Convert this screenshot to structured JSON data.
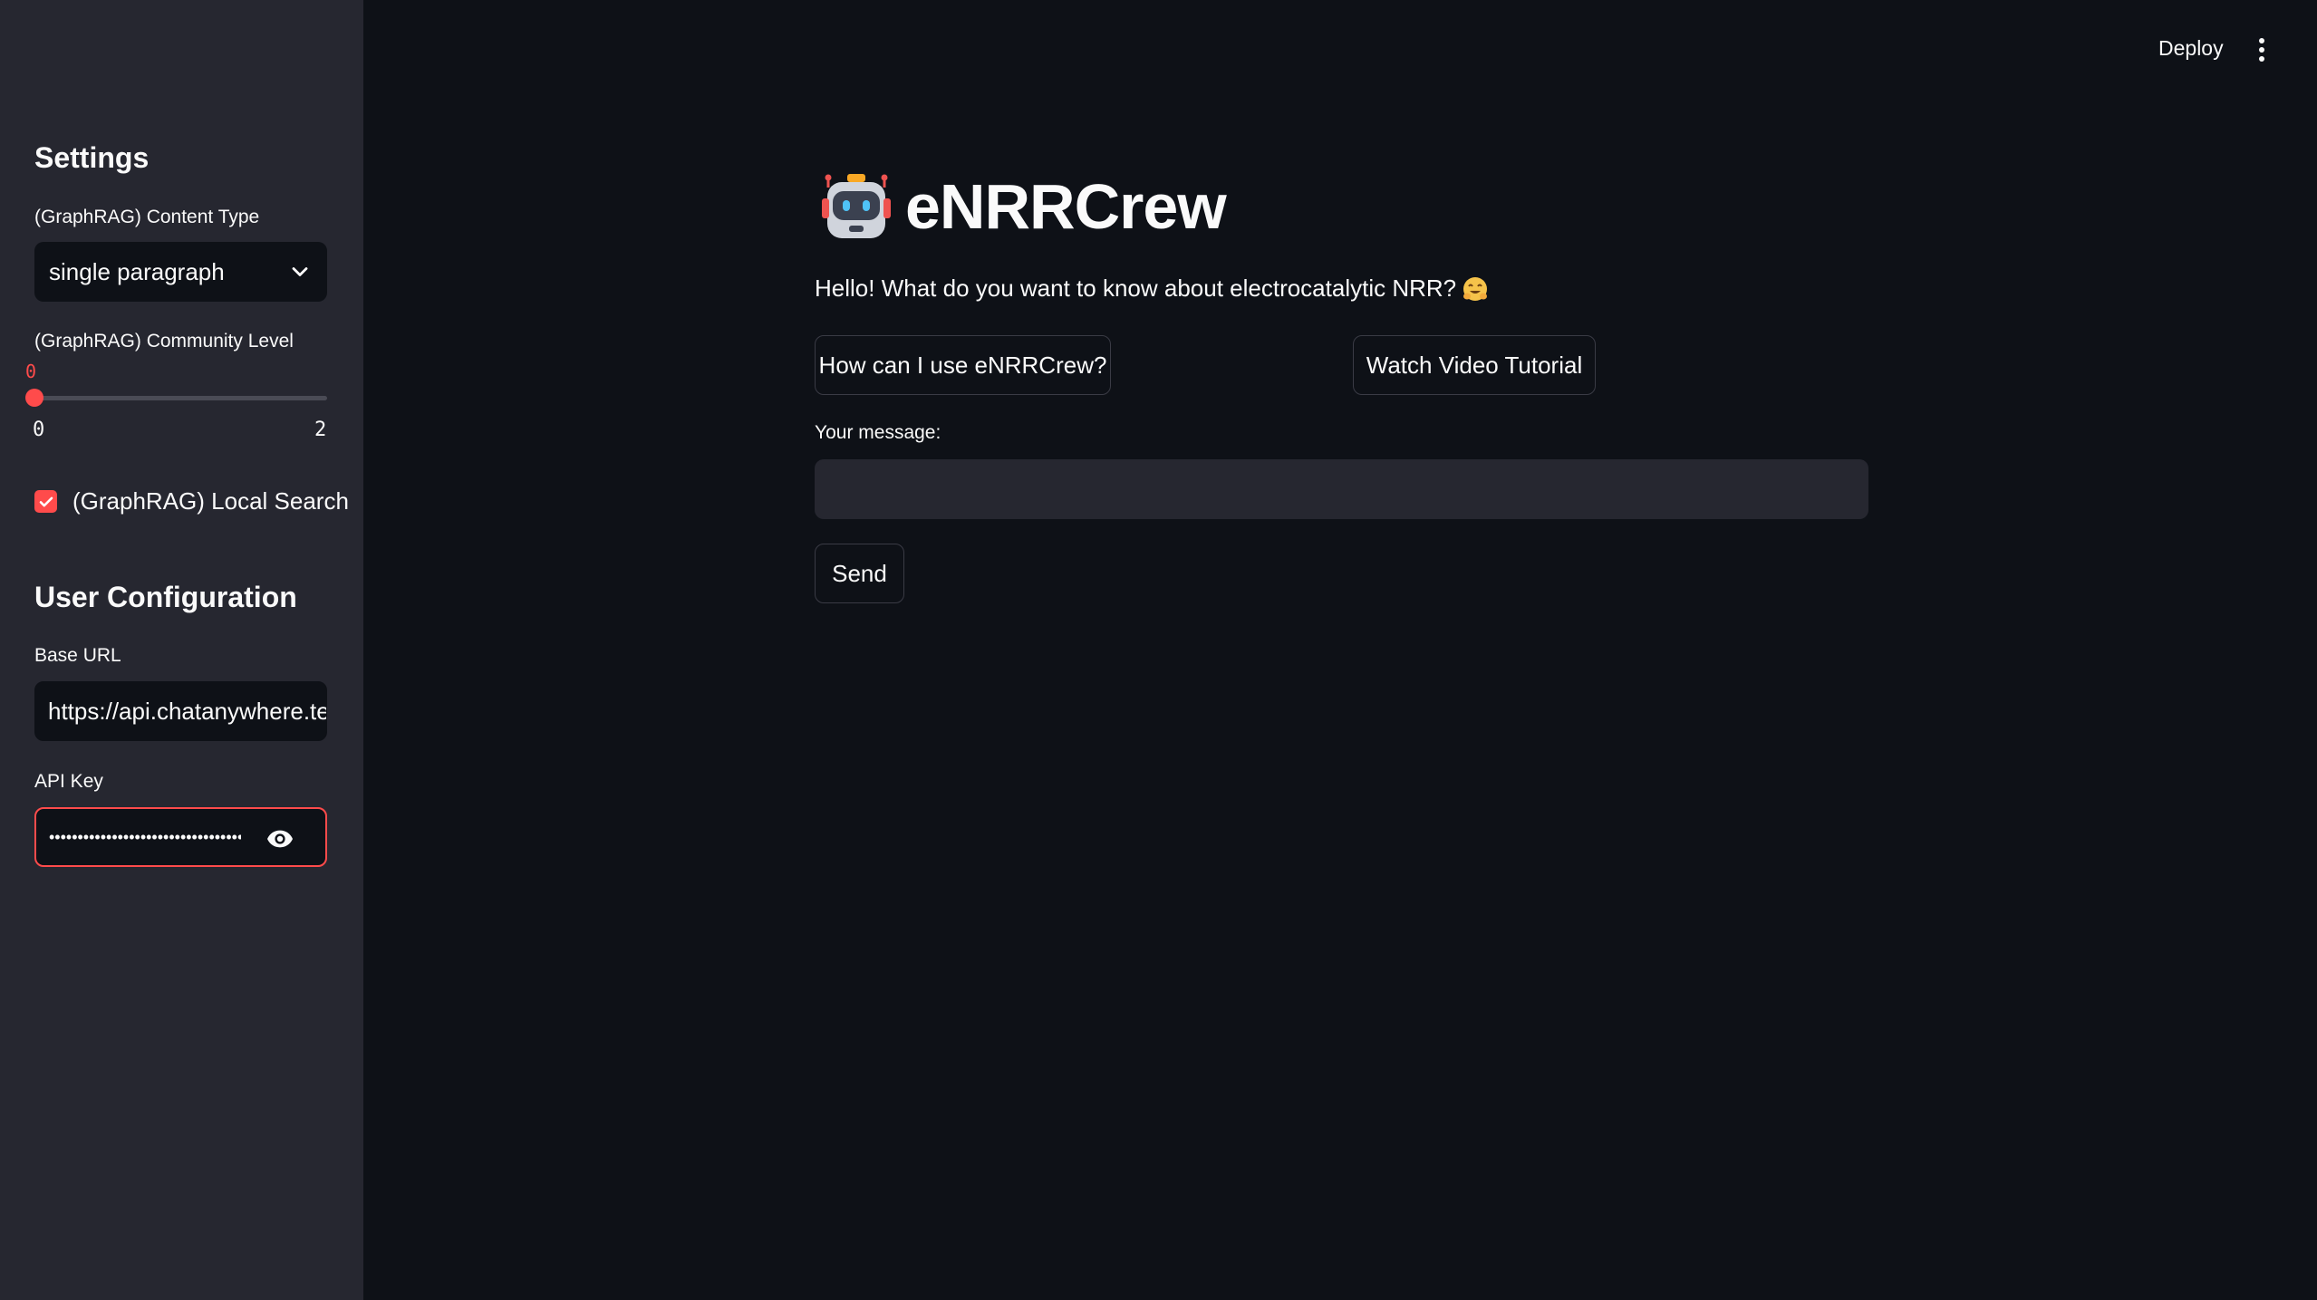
{
  "header": {
    "deploy_label": "Deploy",
    "menu_icon": "kebab-menu-icon"
  },
  "sidebar": {
    "settings_heading": "Settings",
    "content_type": {
      "label": "(GraphRAG) Content Type",
      "selected": "single paragraph"
    },
    "community_level": {
      "label": "(GraphRAG) Community Level",
      "value": "0",
      "min": "0",
      "max": "2",
      "fraction": 0
    },
    "local_search": {
      "label": "(GraphRAG) Local Search",
      "checked": true
    },
    "user_config_heading": "User Configuration",
    "base_url": {
      "label": "Base URL",
      "value": "https://api.chatanywhere.tech"
    },
    "api_key": {
      "label": "API Key",
      "masked_value": "•••••••••••••••••••••••••••••••••••••"
    }
  },
  "main": {
    "title": "eNRRCrew",
    "greeting": "Hello! What do you want to know about electrocatalytic NRR?",
    "buttons": {
      "how_to_use": "How can I use eNRRCrew?",
      "video_tutorial": "Watch Video Tutorial"
    },
    "message_label": "Your message:",
    "message_value": "",
    "send_label": "Send"
  },
  "colors": {
    "accent": "#ff4b4b",
    "sidebar_bg": "#262730",
    "main_bg": "#0e1117"
  }
}
